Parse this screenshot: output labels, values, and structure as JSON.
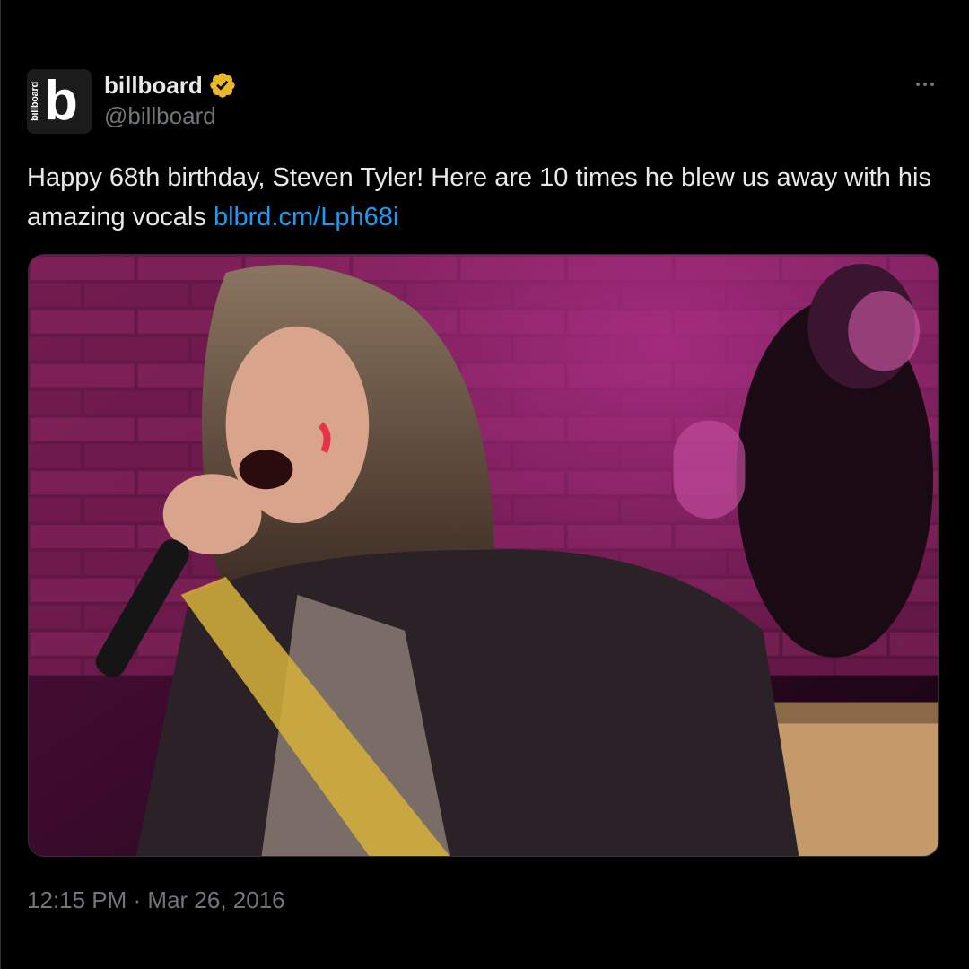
{
  "account": {
    "display_name": "billboard",
    "handle": "@billboard",
    "verified": true,
    "verified_badge_color": "#e8b829",
    "avatar_small_text": "billboard",
    "avatar_big_letter": "b"
  },
  "tweet": {
    "text_main": "Happy 68th birthday, Steven Tyler! Here are 10 times he blew us away with his amazing vocals ",
    "link_text": "blbrd.cm/Lph68i",
    "timestamp_time": "12:15 PM",
    "timestamp_separator": " · ",
    "timestamp_date": "Mar 26, 2016"
  },
  "icons": {
    "more": "more-horizontal-icon",
    "verified": "verified-badge-icon"
  },
  "colors": {
    "background": "#000000",
    "text_primary": "#e7e9ea",
    "text_secondary": "#71767b",
    "link": "#1d9bf0"
  }
}
